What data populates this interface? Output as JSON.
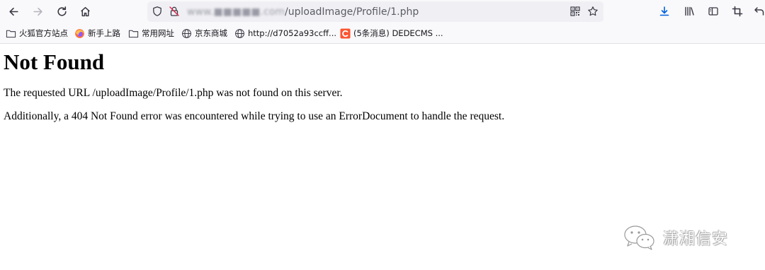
{
  "url": {
    "host_blurred": "www.■■■■■.com",
    "path": "/uploadImage/Profile/1.php"
  },
  "toolbar": {
    "icons": [
      "back-icon",
      "forward-icon",
      "reload-icon",
      "home-icon",
      "shield-icon",
      "insecure-lock-icon",
      "qr-code-icon",
      "star-icon",
      "download-icon",
      "library-icon",
      "sidebar-icon",
      "screenshot-icon",
      "undo-icon"
    ]
  },
  "bookmarks": [
    {
      "icon": "folder-icon",
      "label": "火狐官方站点"
    },
    {
      "icon": "firefox-icon",
      "label": "新手上路"
    },
    {
      "icon": "folder-icon",
      "label": "常用网址"
    },
    {
      "icon": "globe-icon",
      "label": "京东商城"
    },
    {
      "icon": "globe-icon",
      "label": "http://d7052a93ccff..."
    },
    {
      "icon": "csdn-icon",
      "label": "(5条消息) DEDECMS ..."
    }
  ],
  "page": {
    "title": "Not Found",
    "line1": "The requested URL /uploadImage/Profile/1.php was not found on this server.",
    "line2": "Additionally, a 404 Not Found error was encountered while trying to use an ErrorDocument to handle the request."
  },
  "watermark": {
    "text": "潇湘信安"
  },
  "colors": {
    "toolbar_bg": "#f9f9fb",
    "urlbar_bg": "#f0f0f4",
    "accent_blue": "#0060df",
    "csdn_red": "#fc5531"
  }
}
